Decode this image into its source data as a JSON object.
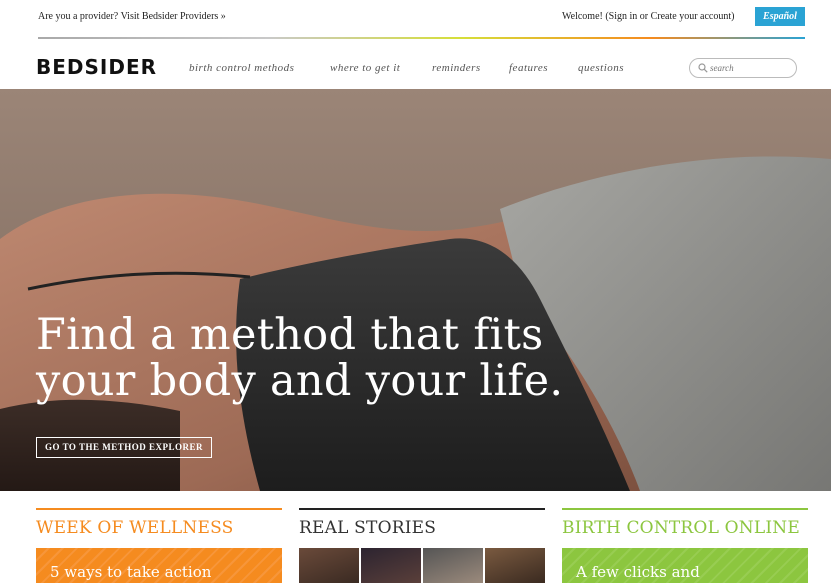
{
  "topbar": {
    "provider_link": "Are you a provider? Visit Bedsider Providers »",
    "welcome": "Welcome! (Sign in or Create your account)",
    "language_button": "Español"
  },
  "nav": {
    "logo": "BEDSIDER",
    "items": [
      "birth control methods",
      "where to get it",
      "reminders",
      "features",
      "questions"
    ],
    "search_placeholder": "search"
  },
  "hero": {
    "headline_line1": "Find a method that fits",
    "headline_line2": "your body and your life.",
    "cta": "GO TO THE METHOD EXPLORER"
  },
  "columns": [
    {
      "title": "WEEK OF WELLNESS",
      "box_text": "5 ways to take action",
      "color": "#f58b1f"
    },
    {
      "title": "REAL STORIES",
      "box_text": "",
      "color": "#222222"
    },
    {
      "title": "BIRTH CONTROL ONLINE",
      "box_text": "A few clicks and",
      "color": "#8cc63f"
    }
  ],
  "colors": {
    "accent_blue": "#2aa3d4",
    "orange": "#f58b1f",
    "green": "#8cc63f"
  }
}
